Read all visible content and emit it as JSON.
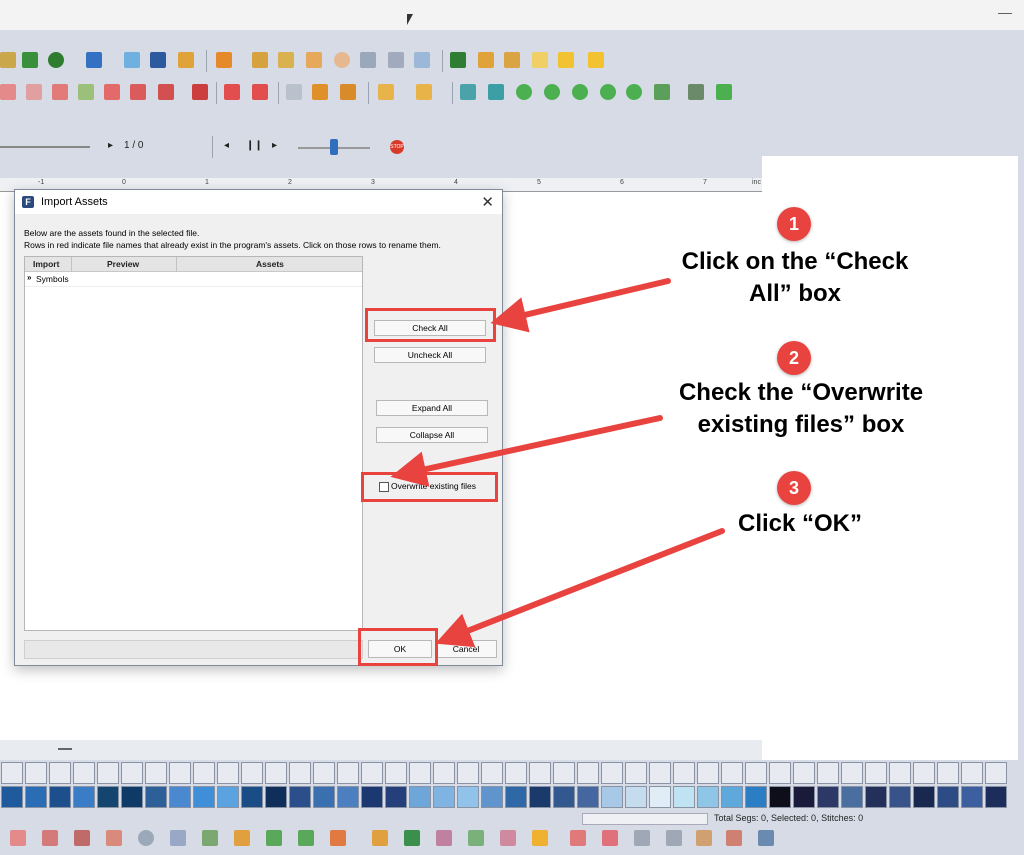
{
  "window": {
    "minimize_glyph": "—"
  },
  "playbar": {
    "frame_counter": "1 / 0",
    "stop_label": "STOP"
  },
  "ruler": {
    "ticks": [
      "-1",
      "0",
      "1",
      "2",
      "3",
      "4",
      "5",
      "6",
      "7",
      "inc"
    ]
  },
  "dialog": {
    "title": "Import Assets",
    "close_glyph": "✕",
    "description_line1": "Below are the assets found in the selected file.",
    "description_line2": "Rows in red indicate file names that already exist in the program's assets. Click on those rows to rename them.",
    "columns": [
      "Import",
      "Preview",
      "Assets"
    ],
    "rows": [
      {
        "expander": "»",
        "label": "Symbols"
      }
    ],
    "buttons": {
      "check_all": "Check All",
      "uncheck_all": "Uncheck All",
      "expand_all": "Expand All",
      "collapse_all": "Collapse All",
      "ok": "OK",
      "cancel": "Cancel"
    },
    "overwrite_label": "Overwrite existing files",
    "overwrite_checked": false
  },
  "annotations": {
    "step1": {
      "number": "1",
      "text_line1": "Click on the “Check",
      "text_line2": "All” box"
    },
    "step2": {
      "number": "2",
      "text_line1": "Check the “Overwrite",
      "text_line2": "existing files” box"
    },
    "step3": {
      "number": "3",
      "text_line1": "Click “OK”"
    },
    "accent": "#e8433f"
  },
  "status": {
    "text": "Total Segs: 0, Selected: 0, Stitches: 0"
  },
  "palette": {
    "colors": [
      "#1f5a9c",
      "#2a6db5",
      "#1d4f8c",
      "#3a7cc6",
      "#14456f",
      "#0d3a66",
      "#2d5f98",
      "#4a88d0",
      "#3f8fd8",
      "#5aa2e0",
      "#1a4c86",
      "#0f2f5a",
      "#2b4f8a",
      "#3a6fb0",
      "#4b7fc0",
      "#1b3870",
      "#243f7a",
      "#6fa6d9",
      "#7fb4e2",
      "#90c2ea",
      "#5f95cc",
      "#2e68a6",
      "#1a3a6c",
      "#33578f",
      "#4567a0",
      "#a7c8e6",
      "#c5dcef",
      "#e0ecf6",
      "#bfe3f2",
      "#8fc6e8",
      "#5ea8dc",
      "#2c7ec4",
      "#0e0e1a",
      "#1a1a3a",
      "#2c3866",
      "#4a6ea0",
      "#22305a",
      "#38528a",
      "#18284f",
      "#2d4c86",
      "#3c5fa0",
      "#1c2d5c"
    ]
  }
}
